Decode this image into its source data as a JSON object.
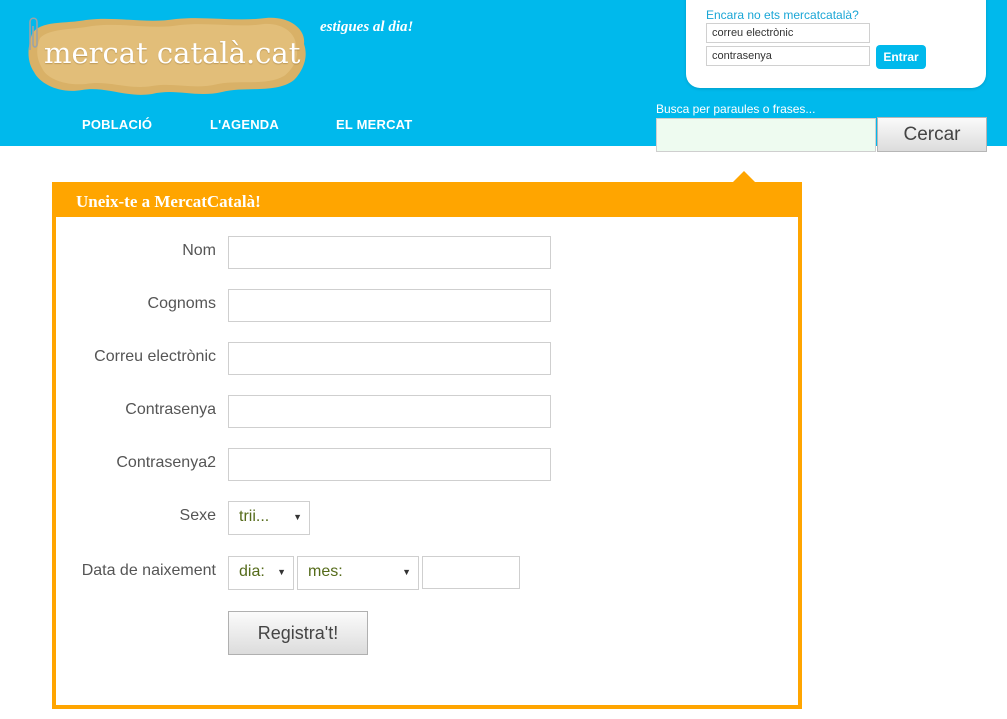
{
  "brand": {
    "logo_text": "mercat català.cat",
    "tagline": "estigues al dia!"
  },
  "login": {
    "prompt": "Encara no ets mercatcatalà?",
    "email_value": "correu electrònic",
    "password_value": "contrasenya",
    "submit_label": "Entrar"
  },
  "nav": {
    "items": [
      {
        "label": "POBLACIÓ"
      },
      {
        "label": "L'AGENDA"
      },
      {
        "label": "EL MERCAT"
      }
    ]
  },
  "search": {
    "label": "Busca per paraules o frases...",
    "value": "",
    "button_label": "Cercar"
  },
  "signup": {
    "title": "Uneix-te a MercatCatalà!",
    "fields": {
      "name_label": "Nom",
      "surname_label": "Cognoms",
      "email_label": "Correu electrònic",
      "password_label": "Contrasenya",
      "password2_label": "Contrasenya2",
      "gender_label": "Sexe",
      "birthdate_label": "Data de naixement"
    },
    "gender_select": {
      "selected": "trii..."
    },
    "day_select": {
      "selected": "dia:"
    },
    "month_select": {
      "selected": "mes:"
    },
    "year_value": "",
    "submit_label": "Registra't!"
  },
  "colors": {
    "header_blue": "#00b9ec",
    "accent_orange": "#ffa500",
    "link_blue": "#1aa6d6",
    "select_text_olive": "#556b1a"
  }
}
